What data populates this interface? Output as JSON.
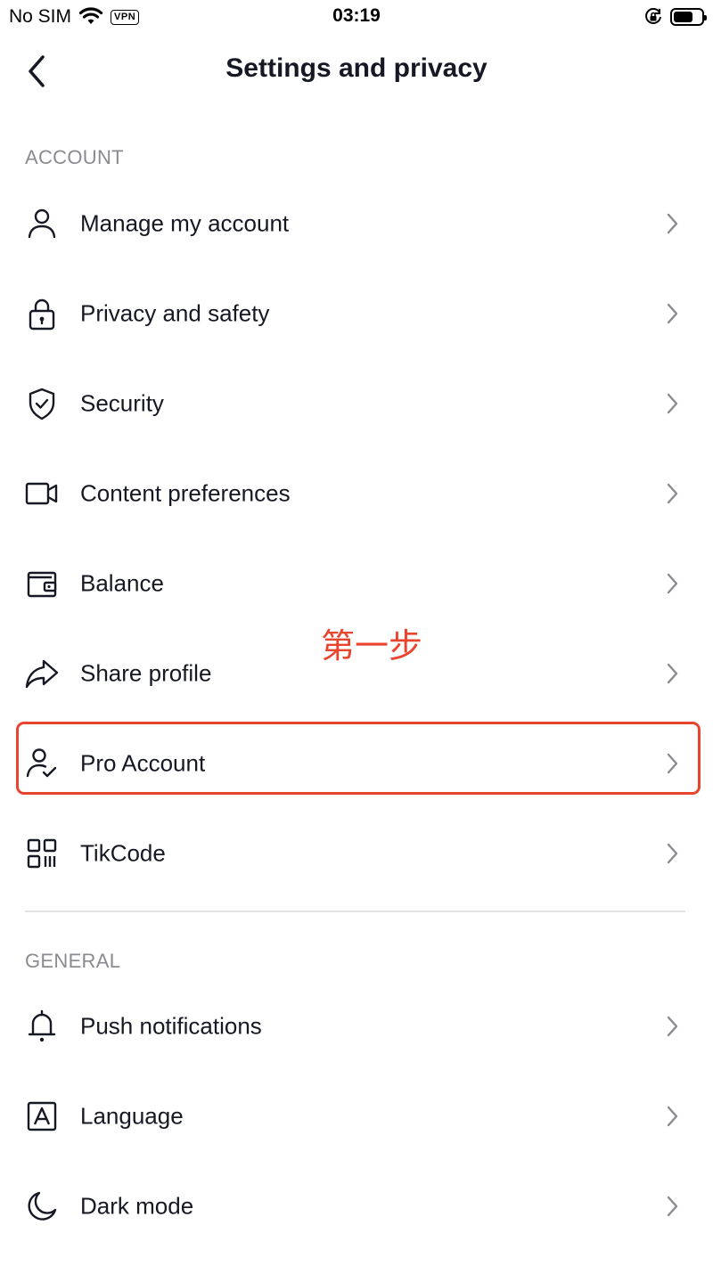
{
  "status_bar": {
    "carrier": "No SIM",
    "vpn": "VPN",
    "time": "03:19"
  },
  "nav": {
    "title": "Settings and privacy",
    "back_icon": "chevron-left-icon"
  },
  "sections": {
    "account": {
      "header": "ACCOUNT",
      "items": [
        {
          "label": "Manage my account",
          "icon": "person-icon"
        },
        {
          "label": "Privacy and safety",
          "icon": "lock-icon"
        },
        {
          "label": "Security",
          "icon": "shield-check-icon"
        },
        {
          "label": "Content preferences",
          "icon": "video-camera-icon"
        },
        {
          "label": "Balance",
          "icon": "wallet-icon"
        },
        {
          "label": "Share profile",
          "icon": "share-arrow-icon"
        },
        {
          "label": "Pro Account",
          "icon": "person-check-icon"
        },
        {
          "label": "TikCode",
          "icon": "qr-code-icon"
        }
      ]
    },
    "general": {
      "header": "GENERAL",
      "items": [
        {
          "label": "Push notifications",
          "icon": "bell-icon"
        },
        {
          "label": "Language",
          "icon": "language-a-icon"
        },
        {
          "label": "Dark mode",
          "icon": "moon-icon"
        }
      ]
    }
  },
  "annotation": {
    "text": "第一步",
    "color": "#e8442e"
  }
}
